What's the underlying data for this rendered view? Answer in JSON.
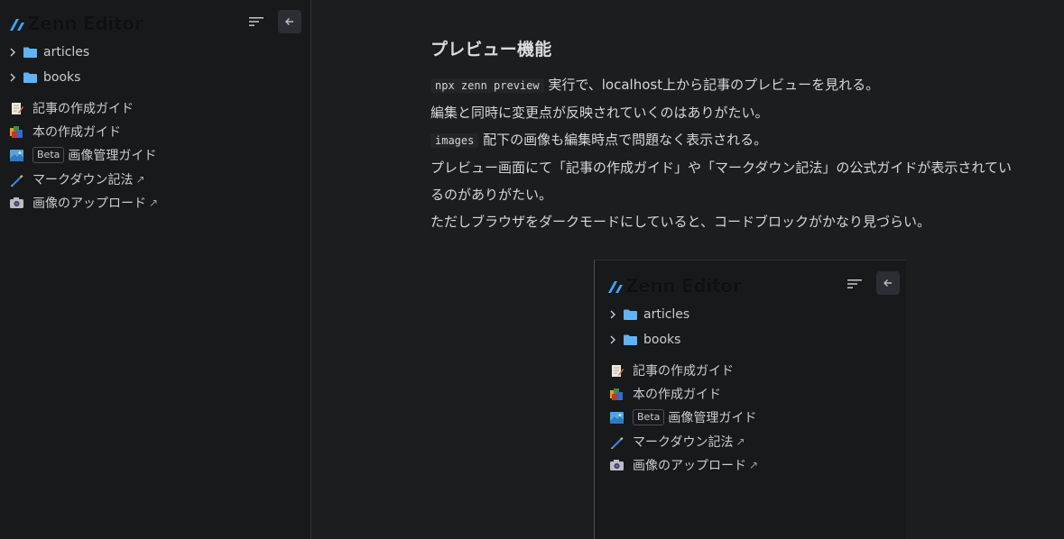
{
  "sidebar": {
    "logo_text": "Zenn Editor",
    "folders": [
      {
        "label": "articles"
      },
      {
        "label": "books"
      }
    ],
    "links": [
      {
        "label": "記事の作成ガイド",
        "icon": "memo-icon",
        "external": false
      },
      {
        "label": "本の作成ガイド",
        "icon": "books-icon",
        "external": false
      },
      {
        "label": "画像管理ガイド",
        "icon": "image-icon",
        "external": false,
        "badge": "Beta"
      },
      {
        "label": "マークダウン記法",
        "icon": "pen-icon",
        "external": true
      },
      {
        "label": "画像のアップロード",
        "icon": "camera-icon",
        "external": true
      }
    ],
    "external_glyph": "↗"
  },
  "article": {
    "heading": "プレビュー機能",
    "line1_code": "npx zenn preview",
    "line1_text": " 実行で、localhost上から記事のプレビューを見れる。",
    "line2": "編集と同時に変更点が反映されていくのはありがたい。",
    "line3_code": "images",
    "line3_text": " 配下の画像も編集時点で問題なく表示される。",
    "line4": "プレビュー画面にて「記事の作成ガイド」や「マークダウン記法」の公式ガイドが表示されてい",
    "line5": "るのがありがたい。",
    "line6": "ただしブラウザをダークモードにしていると、コードブロックがかなり見づらい。"
  },
  "colors": {
    "logo_accent": "#3ea8ff",
    "folder": "#5fb3f6",
    "background": "#1c1d1f",
    "sidebar_bg": "#18191b"
  }
}
